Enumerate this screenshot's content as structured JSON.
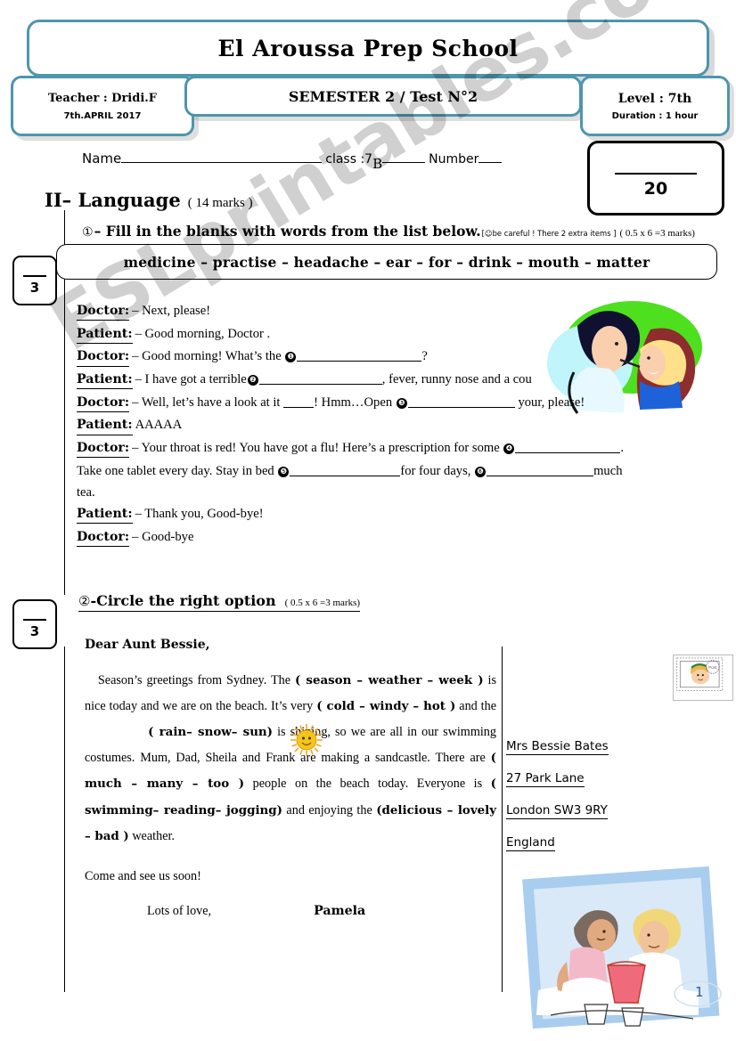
{
  "header": {
    "school": "El Aroussa Prep School",
    "teacher_label": "Teacher : Dridi.F",
    "date": "7th.APRIL   2017",
    "test_title": "SEMESTER 2  /  Test N°2",
    "level": "Level : 7th",
    "duration": "Duration : 1 hour"
  },
  "identity": {
    "name_label": "Name",
    "class_label": "class :7",
    "class_letter": "B",
    "number_label": "Number"
  },
  "score": {
    "denominator": "20"
  },
  "section": {
    "title": "II– Language",
    "marks": "( 14 marks )"
  },
  "marks_margin": {
    "box1": "3",
    "box2": "3"
  },
  "exercise1": {
    "circle": "①",
    "heading": "– Fill in the blanks with words from the list below.",
    "note": "[☺be careful ! There 2 extra items ]",
    "points": "( 0.5 x 6 =3 marks)",
    "word_bank": "medicine – practise – headache – ear – for – drink – mouth – matter",
    "dialogue": [
      {
        "speaker": "Doctor:",
        "text": "– Next, please!"
      },
      {
        "speaker": "Patient:",
        "text": "– Good morning, Doctor ."
      },
      {
        "speaker": "Doctor:",
        "text": "– Good morning! What’s the",
        "blank": "❶",
        "after": "?"
      },
      {
        "speaker": "Patient:",
        "text": "– I have got a terrible",
        "blank": "❷",
        "after": ", fever, runny nose and a cou"
      },
      {
        "speaker": "Doctor:",
        "text": "– Well, let’s have a look at it",
        "mid": "! Hmm…Open",
        "blank": "❸",
        "after": "your, please!"
      },
      {
        "speaker": "Patient:",
        "text": "AAAAA"
      },
      {
        "speaker": "Doctor:",
        "text": "– Your throat is red! You have got a flu! Here’s a prescription for some",
        "blank": "❹",
        "after": "."
      },
      {
        "speaker": "",
        "text": "Take one tablet   every day.  Stay in bed",
        "blank": "❺",
        "mid2": "for four days,",
        "blank2": "❻",
        "after": "much"
      },
      {
        "speaker": "",
        "text": "tea."
      },
      {
        "speaker": "Patient:",
        "text": "– Thank you, Good-bye!"
      },
      {
        "speaker": "Doctor:",
        "text": "– Good-bye"
      }
    ]
  },
  "exercise2": {
    "circle": "②",
    "heading": "-Circle the right option",
    "points": "( 0.5 x 6 =3 marks)",
    "letter": {
      "salutation": "Dear Aunt Bessie,",
      "body_part1": "Season’s greetings from Sydney. The",
      "option1": "( season – weather – week )",
      "body_part2": "is nice today and we are on the beach. It’s very",
      "option2": "( cold – windy – hot )",
      "body_part3": "and the",
      "option3": "( rain– snow– sun)",
      "body_part4": "is shining, so we are all in our swimming costumes. Mum, Dad, Sheila and Frank are making a sandcastle. There are",
      "option4": "( much – many – too )",
      "body_part5": "people on the beach today. Everyone is",
      "option5": "(  swimming–  reading–  jogging)",
      "body_part6": "and enjoying the",
      "option6": "(delicious – lovely – bad )",
      "body_part7": "weather.",
      "closing": "Come and see us soon!",
      "signoff": "Lots of love,",
      "signature": "Pamela"
    },
    "address": [
      "Mrs Bessie Bates",
      "27 Park Lane",
      "London SW3 9RY",
      "England"
    ]
  },
  "images": {
    "doctor_scene": "doctor-examining-patient-illustration",
    "sun": "smiling-sun-icon",
    "stamp": "postage-stamp-image",
    "sandcastle_scene": "children-building-sandcastle-illustration"
  },
  "watermark": "ESLprintables.com",
  "page_number": "1",
  "colors": {
    "header_border": "#4d96ad",
    "page_number": "#2f5f8f",
    "sun": "#f5c518"
  }
}
